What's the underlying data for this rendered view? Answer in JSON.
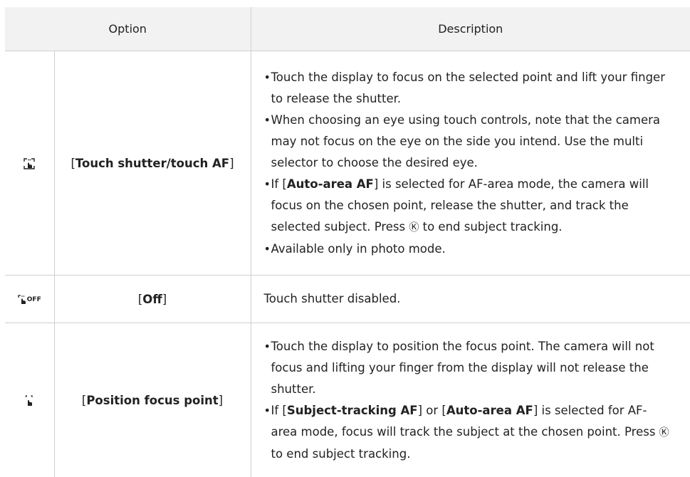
{
  "headers": {
    "option": "Option",
    "description": "Description"
  },
  "rows": [
    {
      "icon": "touch-shutter-icon",
      "option_prefix": "[",
      "option": "Touch shutter/touch AF",
      "option_suffix": "]",
      "bullets": [
        "Touch the display to focus on the selected point and lift your finger to release the shutter.",
        "When choosing an eye using touch controls, note that the camera may not focus on the eye on the side you intend. Use the multi selector to choose the desired eye.",
        {
          "pre": "If [",
          "bold": "Auto-area AF",
          "post": "] is selected for AF-area mode, the camera will focus on the chosen point, release the shutter, and track the selected subject. Press ",
          "ok": "Ⓚ",
          "end": " to end subject tracking."
        },
        "Available only in photo mode."
      ]
    },
    {
      "icon": "touch-shutter-off-icon",
      "icon_text": "OFF",
      "option_prefix": "[",
      "option": "Off",
      "option_suffix": "]",
      "description": "Touch shutter disabled."
    },
    {
      "icon": "position-focus-point-icon",
      "option_prefix": "[",
      "option": "Position focus point",
      "option_suffix": "]",
      "bullets": [
        "Touch the display to position the focus point. The camera will not focus and lifting your finger from the display will not release the shutter.",
        {
          "pre": "If [",
          "bold": "Subject-tracking AF",
          "mid": "] or [",
          "bold2": "Auto-area AF",
          "post": "] is selected for AF-area mode, focus will track the subject at the chosen point. Press ",
          "ok": "Ⓚ",
          "end": " to end subject tracking."
        }
      ]
    }
  ]
}
